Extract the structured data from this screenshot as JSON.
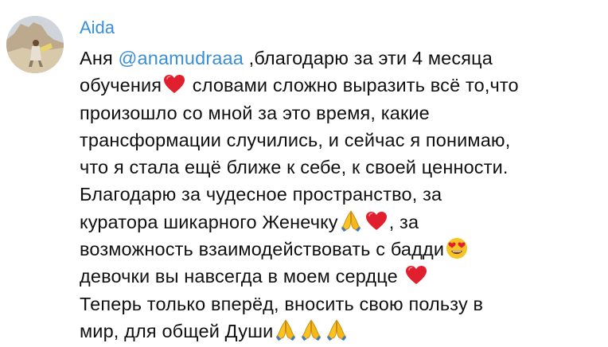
{
  "message": {
    "author": "Aida",
    "lines": [
      {
        "before": "Аня ",
        "mention": "@anamudraaa",
        "after": " ,благодарю за эти 4 месяца"
      },
      {
        "t1": "обучения",
        "t2": " словами сложно выразить всё то,что"
      },
      {
        "t1": "произошло со мной за это время, какие"
      },
      {
        "t1": "трансформации случились, и сейчас я понимаю,"
      },
      {
        "t1": "что я стала ещё ближе к себе, к своей ценности."
      },
      {
        "t1": "Благодарю за чудесное пространство, за"
      },
      {
        "t1": "куратора шикарного Женечку",
        "t2": ", за"
      },
      {
        "t1": "возможность взаимодействовать с бадди"
      },
      {
        "t1": "девочки вы навсегда в моем сердце "
      },
      {
        "t1": "Теперь  только вперёд, вносить свою пользу в"
      },
      {
        "t1": "мир, для общей Души"
      }
    ],
    "emoji_icons": {
      "heart": "red-heart",
      "pray": "folded-hands",
      "heart_eyes": "heart-eyes-face"
    },
    "colors": {
      "author": "#3a8fd6",
      "mention": "#3a8fd6",
      "text": "#111111",
      "heart": "#e0202e",
      "emoji_yellow": "#f7c325"
    }
  }
}
